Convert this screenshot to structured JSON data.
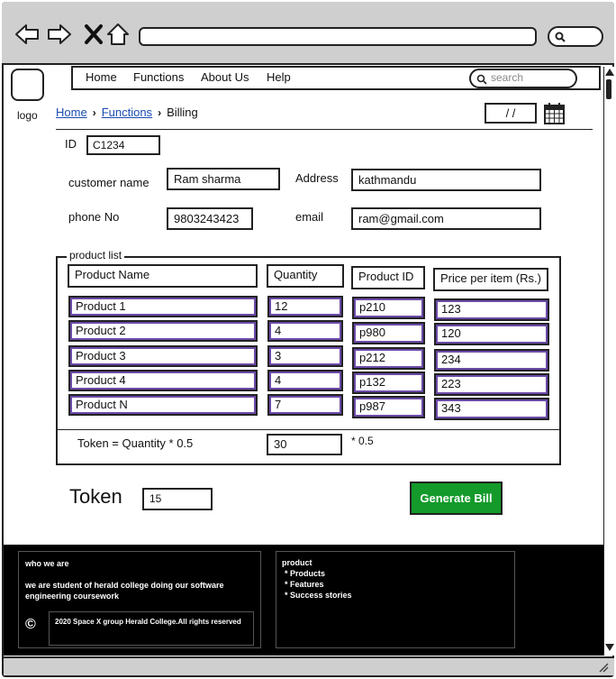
{
  "browser": {
    "back_icon": "arrow-left-icon",
    "forward_icon": "arrow-right-icon",
    "close_icon": "x-icon",
    "home_icon": "home-icon",
    "url": "",
    "search_icon": "search-icon"
  },
  "header": {
    "logo_label": "logo",
    "menu": [
      "Home",
      "Functions",
      "About Us",
      "Help"
    ],
    "search_placeholder": "search"
  },
  "breadcrumb": {
    "items": [
      "Home",
      "Functions",
      "Billing"
    ]
  },
  "date_field": "/ /",
  "form": {
    "id_label": "ID",
    "id_value": "C1234",
    "customer_name_label": "customer name",
    "customer_name_value": "Ram sharma",
    "address_label": "Address",
    "address_value": "kathmandu",
    "phone_label": "phone No",
    "phone_value": "9803243423",
    "email_label": "email",
    "email_value": "ram@gmail.com"
  },
  "product_list": {
    "legend": "product list",
    "headers": [
      "Product Name",
      "Quantity",
      "Product ID",
      "Price per item (Rs.)"
    ],
    "rows": [
      [
        "Product 1",
        "12",
        "p210",
        "123"
      ],
      [
        "Product 2",
        "4",
        "p980",
        "120"
      ],
      [
        "Product 3",
        "3",
        "p212",
        "234"
      ],
      [
        "Product 4",
        "4",
        "p132",
        "223"
      ],
      [
        "Product N",
        "7",
        "p987",
        "343"
      ]
    ],
    "token_formula": "Token = Quantity * 0.5",
    "token_calc_value": "30",
    "token_calc_suffix": "* 0.5"
  },
  "token": {
    "label": "Token",
    "value": "15"
  },
  "generate_button": "Generate Bill",
  "footer": {
    "who_title": "who we are",
    "who_text": "we are student of herald college doing our software engineering coursework",
    "copyright_symbol": "©",
    "copyright_text": "2020 Space X group Herald College.All rights reserved",
    "product_title": "product",
    "product_items": [
      "* Products",
      "* Features",
      "* Success stories"
    ]
  },
  "colors": {
    "chrome": "#cfcfcf",
    "accent_purple": "#6b4aa8",
    "button_green": "#139a2a",
    "footer_bg": "#000000",
    "link_blue": "#1a4bb0"
  }
}
